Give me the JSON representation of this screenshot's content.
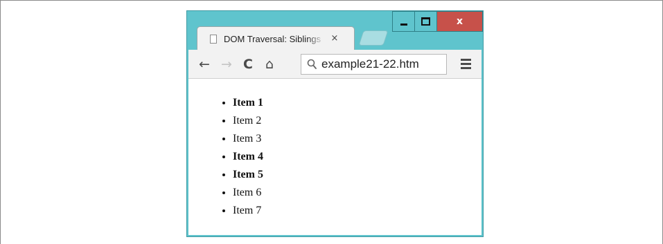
{
  "window_controls": {
    "minimize_icon": "minimize-icon",
    "maximize_icon": "maximize-icon",
    "close_label": "x",
    "close_color": "#c7514a",
    "frame_color": "#5fc4cd"
  },
  "tab": {
    "title": "DOM Traversal: Siblings",
    "close_label": "×",
    "page_icon": "page-icon"
  },
  "toolbar": {
    "back_label": "←",
    "forward_label": "→",
    "reload_label": "C",
    "home_label": "⌂",
    "url": "example21-22.htm",
    "search_icon": "search-icon",
    "menu_icon": "menu-icon"
  },
  "page": {
    "items": [
      {
        "label": "Item 1",
        "bold": true
      },
      {
        "label": "Item 2",
        "bold": false
      },
      {
        "label": "Item 3",
        "bold": false
      },
      {
        "label": "Item 4",
        "bold": true
      },
      {
        "label": "Item 5",
        "bold": true
      },
      {
        "label": "Item 6",
        "bold": false
      },
      {
        "label": "Item 7",
        "bold": false
      }
    ]
  }
}
